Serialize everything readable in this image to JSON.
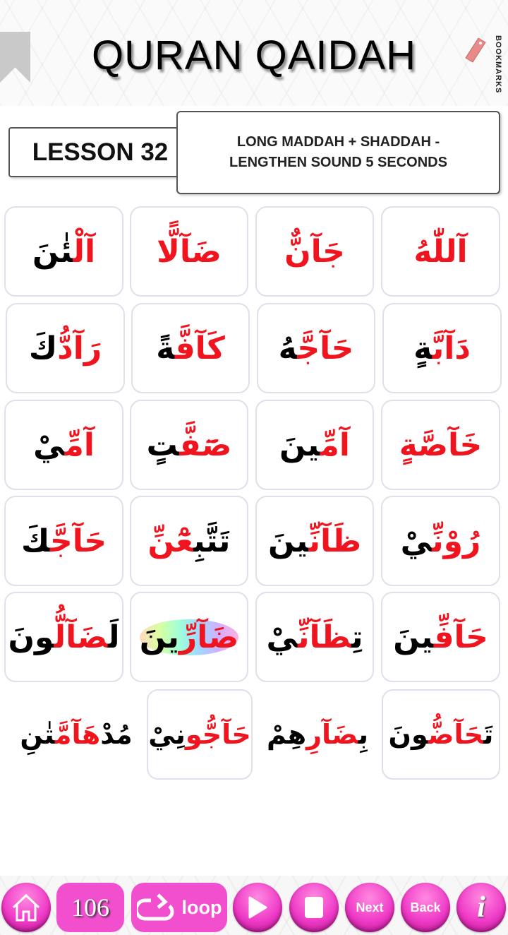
{
  "header": {
    "title": "QURAN QAIDAH",
    "bookmarks_label": "BOOKMARKS"
  },
  "lesson": {
    "label": "LESSON 32",
    "description_line1": "LONG MADDAH + SHADDAH -",
    "description_line2": "LENGTHEN SOUND 5 SECONDS"
  },
  "words": [
    [
      [
        {
          "c": "r",
          "t": "آللّٰهُ"
        }
      ],
      [
        {
          "c": "r",
          "t": "جَآنٌّ"
        }
      ],
      [
        {
          "c": "r",
          "t": "ضَآلًّا"
        }
      ],
      [
        {
          "c": "r",
          "t": "آلْ"
        },
        {
          "c": "k",
          "t": "ئٰنَ"
        }
      ]
    ],
    [
      [
        {
          "c": "r",
          "t": "دَآبَّ"
        },
        {
          "c": "k",
          "t": "ةٍ"
        }
      ],
      [
        {
          "c": "r",
          "t": "حَآجَّ"
        },
        {
          "c": "k",
          "t": "هُ"
        }
      ],
      [
        {
          "c": "r",
          "t": "كَآفَّ"
        },
        {
          "c": "k",
          "t": "ةً"
        }
      ],
      [
        {
          "c": "r",
          "t": "رَآدُّ"
        },
        {
          "c": "k",
          "t": "كَ"
        }
      ]
    ],
    [
      [
        {
          "c": "r",
          "t": "خَآصَّةٍ"
        }
      ],
      [
        {
          "c": "r",
          "t": "آمِّ"
        },
        {
          "c": "k",
          "t": "ينَ"
        }
      ],
      [
        {
          "c": "r",
          "t": "صَٓفَّ"
        },
        {
          "c": "k",
          "t": "تٍ"
        }
      ],
      [
        {
          "c": "r",
          "t": "آمِّ"
        },
        {
          "c": "k",
          "t": "يْ"
        }
      ]
    ],
    [
      [
        {
          "c": "r",
          "t": "رُوْنِّ"
        },
        {
          "c": "k",
          "t": "يْ"
        }
      ],
      [
        {
          "c": "r",
          "t": "ظَآنِّ"
        },
        {
          "c": "k",
          "t": "ينَ"
        }
      ],
      [
        {
          "c": "k",
          "t": "تَتَّبِ"
        },
        {
          "c": "r",
          "t": "عْٓنِّ"
        }
      ],
      [
        {
          "c": "r",
          "t": "حَآجَّ"
        },
        {
          "c": "k",
          "t": "كَ"
        }
      ]
    ],
    [
      [
        {
          "c": "r",
          "t": "حَآفِّ"
        },
        {
          "c": "k",
          "t": "ينَ"
        }
      ],
      [
        {
          "c": "k",
          "t": "تِ"
        },
        {
          "c": "r",
          "t": "ظَآنِّ"
        },
        {
          "c": "k",
          "t": "يْ"
        }
      ],
      [
        {
          "c": "r",
          "t": "ضَآرِّ"
        },
        {
          "c": "k",
          "t": "ينَ"
        }
      ],
      [
        {
          "c": "k",
          "t": "لَ"
        },
        {
          "c": "r",
          "t": "ضَآلُّ"
        },
        {
          "c": "k",
          "t": "ونَ"
        }
      ]
    ],
    [
      [
        {
          "c": "k",
          "t": "تَ"
        },
        {
          "c": "r",
          "t": "حَآضُّ"
        },
        {
          "c": "k",
          "t": "ونَ"
        }
      ],
      [
        {
          "c": "k",
          "t": "بِ"
        },
        {
          "c": "r",
          "t": "ضَآرِ"
        },
        {
          "c": "k",
          "t": "هِمْ"
        }
      ],
      [
        {
          "c": "r",
          "t": "حَآجُّو"
        },
        {
          "c": "k",
          "t": "نِيْ"
        }
      ],
      [
        {
          "c": "k",
          "t": "مُدْ"
        },
        {
          "c": "r",
          "t": "هَآمَّ"
        },
        {
          "c": "k",
          "t": "تٰنِ"
        }
      ]
    ]
  ],
  "toolbar": {
    "page_number": "106",
    "loop_label": "loop",
    "next_label": "Next",
    "back_label": "Back",
    "info_label": "i"
  },
  "colors": {
    "accent": "#f03cc8",
    "letter_red": "#f0141e",
    "letter_black": "#000000"
  }
}
